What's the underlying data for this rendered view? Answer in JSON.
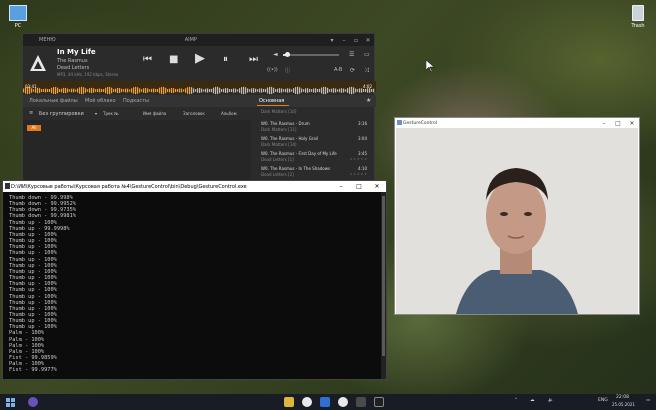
{
  "desktop": {
    "pc_label": "PC",
    "trash_label": "Trash"
  },
  "aimp": {
    "menu_label": "МЕНЮ",
    "window_title": "AIMP",
    "track_title": "In My Life",
    "artist": "The Rasmus",
    "album": "Dead Letters",
    "format_info": "MP3, 44 kHz, 192 kbps, Stereo",
    "time_elapsed": "03:41",
    "time_remaining": "4:02",
    "tabs": [
      "Локальные файлы",
      "Моё облако",
      "Подкасты"
    ],
    "active_playlist_tab": "Основная",
    "group_label": "Без группировки",
    "columns": [
      "Трек №",
      "Имя файла",
      "Заголовок",
      "Альбом"
    ],
    "all_badge": "All",
    "playlist": [
      {
        "name": "",
        "sub": "Dark Matters [10]",
        "dur": "",
        "stars": ""
      },
      {
        "name": "W0. The Rasmus - Drum",
        "sub": "Dark Matters [11]",
        "dur": "3:16",
        "stars": "★ ★ ★ ★ ★"
      },
      {
        "name": "W0. The Rasmus - Holy Grail",
        "sub": "Dark Matters [14]",
        "dur": "3:04",
        "stars": "★ ★ ★ ★ ★"
      },
      {
        "name": "W0. The Rasmus - First Day of My Life",
        "sub": "Dead Letters [1]",
        "dur": "3:45",
        "stars": "★ ★ ★ ★ ★"
      },
      {
        "name": "W0. The Rasmus - In The Shadows",
        "sub": "Dead Letters [2]",
        "dur": "4:10",
        "stars": "★ ★ ★ ★ ★"
      }
    ]
  },
  "console": {
    "title": "D:\\ИИ\\Курсовые работы\\Курсовая работа №4\\GestureControl\\bin\\Debug\\GestureControl.exe",
    "lines": [
      "Thumb down - 99.998%",
      "Thumb down - 99.9952%",
      "Thumb down - 99.9735%",
      "Thumb down - 99.9981%",
      "Thumb up - 100%",
      "Thumb up - 99.9998%",
      "Thumb up - 100%",
      "Thumb up - 100%",
      "Thumb up - 100%",
      "Thumb up - 100%",
      "Thumb up - 100%",
      "Thumb up - 100%",
      "Thumb up - 100%",
      "Thumb up - 100%",
      "Thumb up - 100%",
      "Thumb up - 100%",
      "Thumb up - 100%",
      "Thumb up - 100%",
      "Thumb up - 100%",
      "Thumb up - 100%",
      "Thumb up - 100%",
      "Thumb up - 100%",
      "Palm - 100%",
      "Palm - 100%",
      "Palm - 100%",
      "Palm - 100%",
      "Fist - 99.9859%",
      "Palm - 100%",
      "Fist - 99.9977%"
    ]
  },
  "camera": {
    "title": "GestureControl"
  },
  "taskbar": {
    "lang": "ENG",
    "time": "22:08",
    "date": "25.05.2021"
  }
}
